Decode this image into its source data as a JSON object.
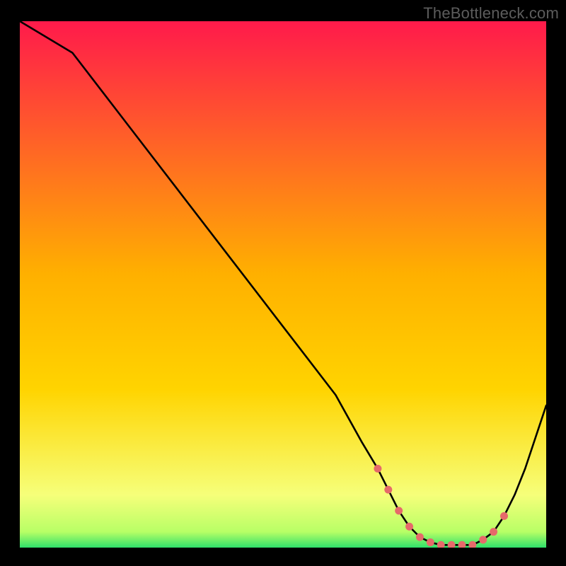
{
  "watermark": "TheBottleneck.com",
  "colors": {
    "bg": "#000000",
    "curve": "#000000",
    "marker": "#e66a6a",
    "gradient_top": "#ff1a4b",
    "gradient_mid": "#ffd400",
    "gradient_low": "#f6ff7a",
    "gradient_bot": "#2fe06a"
  },
  "chart_data": {
    "type": "line",
    "title": "",
    "xlabel": "",
    "ylabel": "",
    "xlim": [
      0,
      100
    ],
    "ylim": [
      0,
      100
    ],
    "x": [
      0,
      10,
      20,
      30,
      40,
      50,
      60,
      65,
      68,
      70,
      72,
      74,
      76,
      78,
      80,
      82,
      84,
      86,
      88,
      90,
      92,
      94,
      96,
      98,
      100
    ],
    "values": [
      100,
      94,
      81,
      68,
      55,
      42,
      29,
      20,
      15,
      11,
      7,
      4,
      2,
      1,
      0.5,
      0.5,
      0.5,
      0.5,
      1.5,
      3,
      6,
      10,
      15,
      21,
      27
    ],
    "markers": {
      "x": [
        68,
        70,
        72,
        74,
        76,
        78,
        80,
        82,
        84,
        86,
        88,
        90,
        92
      ],
      "y": [
        15,
        11,
        7,
        4,
        2,
        1,
        0.5,
        0.5,
        0.5,
        0.5,
        1.5,
        3,
        6
      ]
    }
  }
}
